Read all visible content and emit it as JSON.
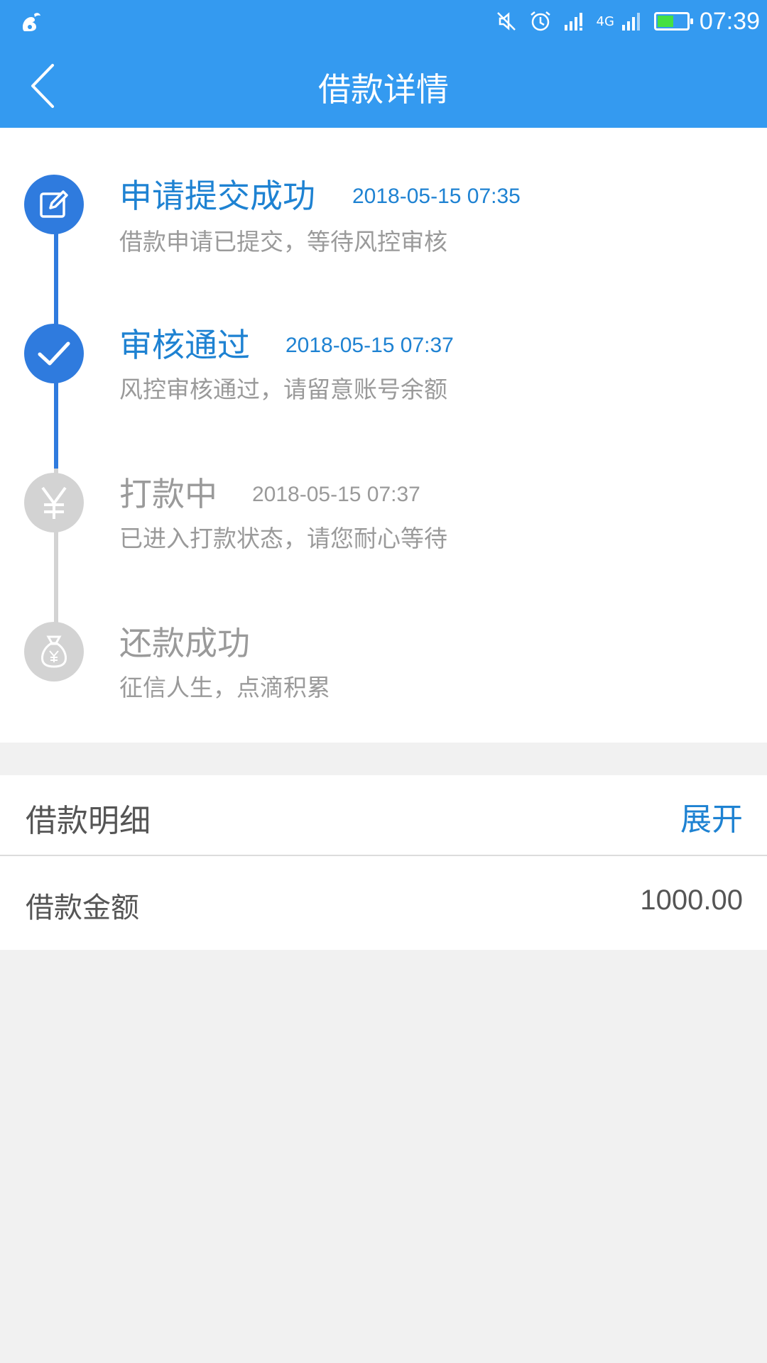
{
  "status_bar": {
    "time": "07:39",
    "network_label": "4G",
    "battery_level": 0.55,
    "icons": [
      "app-icon",
      "mute-icon",
      "alarm-icon",
      "signal-icon",
      "signal-4g-icon",
      "battery-icon"
    ]
  },
  "nav": {
    "title": "借款详情",
    "back_icon": "chevron-left-icon"
  },
  "timeline": {
    "steps": [
      {
        "title": "申请提交成功",
        "time": "2018-05-15 07:35",
        "desc": "借款申请已提交，等待风控审核",
        "icon": "edit-icon",
        "state": "done"
      },
      {
        "title": "审核通过",
        "time": "2018-05-15 07:37",
        "desc": "风控审核通过，请留意账号余额",
        "icon": "check-icon",
        "state": "done"
      },
      {
        "title": "打款中",
        "time": "2018-05-15 07:37",
        "desc": "已进入打款状态，请您耐心等待",
        "icon": "yen-icon",
        "state": "pending"
      },
      {
        "title": "还款成功",
        "time": "",
        "desc": "征信人生，点滴积累",
        "icon": "money-bag-icon",
        "state": "pending"
      }
    ]
  },
  "details": {
    "title": "借款明细",
    "expand_label": "展开",
    "amount_label": "借款金额",
    "amount_value": "1000.00"
  },
  "colors": {
    "header_bg": "#349af0",
    "active": "#2f7bde",
    "active_text": "#1e82d2",
    "inactive": "#d3d3d3",
    "battery": "#44e043"
  }
}
